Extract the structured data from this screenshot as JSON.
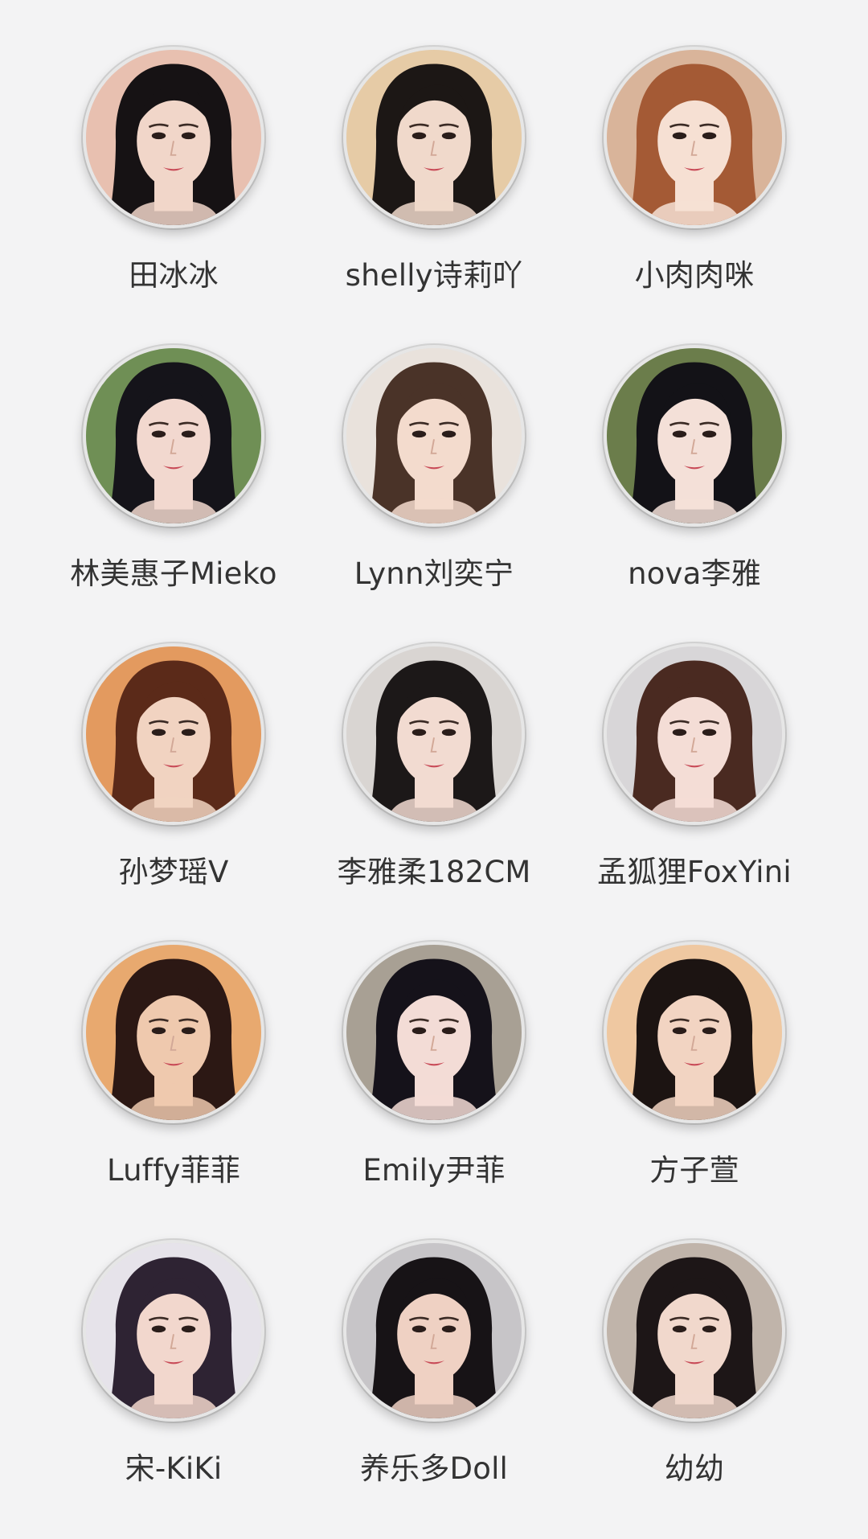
{
  "profiles": [
    {
      "name": "田冰冰",
      "bg": "#e8c0b0",
      "hair": "#161214",
      "skin": "#f1d6c9"
    },
    {
      "name": "shelly诗莉吖",
      "bg": "#e6cba6",
      "hair": "#1c1715",
      "skin": "#f0d9cb"
    },
    {
      "name": "小肉肉咪",
      "bg": "#d9b49a",
      "hair": "#a45a35",
      "skin": "#f6e0d3"
    },
    {
      "name": "林美惠子Mieko",
      "bg": "#6f8f55",
      "hair": "#15141a",
      "skin": "#f2d8cf"
    },
    {
      "name": "Lynn刘奕宁",
      "bg": "#e9e2dc",
      "hair": "#4a3328",
      "skin": "#f3dbcd"
    },
    {
      "name": "nova李雅",
      "bg": "#6b7d4b",
      "hair": "#131217",
      "skin": "#f4e0d8"
    },
    {
      "name": "孙梦瑶V",
      "bg": "#e39a5f",
      "hair": "#5b2a19",
      "skin": "#f1d3c1"
    },
    {
      "name": "李雅柔182CM",
      "bg": "#d9d5d2",
      "hair": "#1c1818",
      "skin": "#f2dbd1"
    },
    {
      "name": "孟狐狸FoxYini",
      "bg": "#d8d6d8",
      "hair": "#4a2a21",
      "skin": "#f4ddd6"
    },
    {
      "name": "Luffy菲菲",
      "bg": "#e8a96f",
      "hair": "#2c1814",
      "skin": "#efc9ae"
    },
    {
      "name": "Emily尹菲",
      "bg": "#a8a094",
      "hair": "#15121a",
      "skin": "#f3dcd6"
    },
    {
      "name": "方子萱",
      "bg": "#efc8a1",
      "hair": "#1c1412",
      "skin": "#f2d4c2"
    },
    {
      "name": "宋-KiKi",
      "bg": "#e6e3ea",
      "hair": "#2e2333",
      "skin": "#f2d7cd"
    },
    {
      "name": "养乐多Doll",
      "bg": "#c7c5c8",
      "hair": "#171316",
      "skin": "#efd1c3"
    },
    {
      "name": "幼幼",
      "bg": "#c0b4aa",
      "hair": "#1d1617",
      "skin": "#f1d8cc"
    }
  ]
}
